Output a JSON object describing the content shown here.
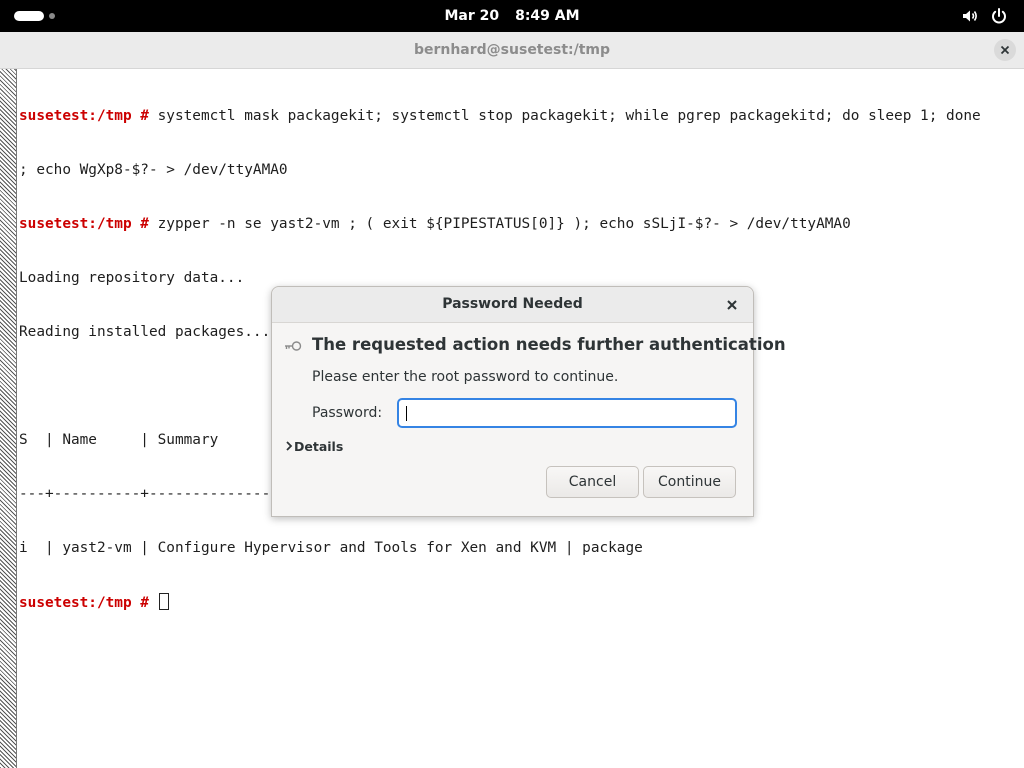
{
  "topbar": {
    "date": "Mar 20",
    "time": "8:49 AM",
    "icons": [
      "activities-indicator",
      "volume-icon",
      "power-icon"
    ]
  },
  "window": {
    "title": "bernhard@susetest:/tmp",
    "close_icon": "close-icon"
  },
  "terminal": {
    "lines": [
      {
        "prompt": "susetest:/tmp # ",
        "text": "systemctl mask packagekit; systemctl stop packagekit; while pgrep packagekitd; do sleep 1; done"
      },
      {
        "prompt": "",
        "text": "; echo WgXp8-$?- > /dev/ttyAMA0"
      },
      {
        "prompt": "susetest:/tmp # ",
        "text": "zypper -n se yast2-vm ; ( exit ${PIPESTATUS[0]} ); echo sSLjI-$?- > /dev/ttyAMA0"
      },
      {
        "prompt": "",
        "text": "Loading repository data..."
      },
      {
        "prompt": "",
        "text": "Reading installed packages..."
      },
      {
        "prompt": "",
        "text": ""
      },
      {
        "prompt": "",
        "text": "S  | Name     | Summary                                         | Type"
      },
      {
        "prompt": "",
        "text": "---+----------+-------------------------------------------------+--------"
      },
      {
        "prompt": "",
        "text": "i  | yast2-vm | Configure Hypervisor and Tools for Xen and KVM | package"
      },
      {
        "prompt": "susetest:/tmp # ",
        "text": ""
      }
    ]
  },
  "dialog": {
    "title": "Password Needed",
    "heading": "The requested action needs further authentication",
    "message": "Please enter the root password to continue.",
    "password_label": "Password:",
    "password_value": "",
    "details_label": "Details",
    "cancel_label": "Cancel",
    "continue_label": "Continue",
    "accent_color": "#3584e4"
  }
}
